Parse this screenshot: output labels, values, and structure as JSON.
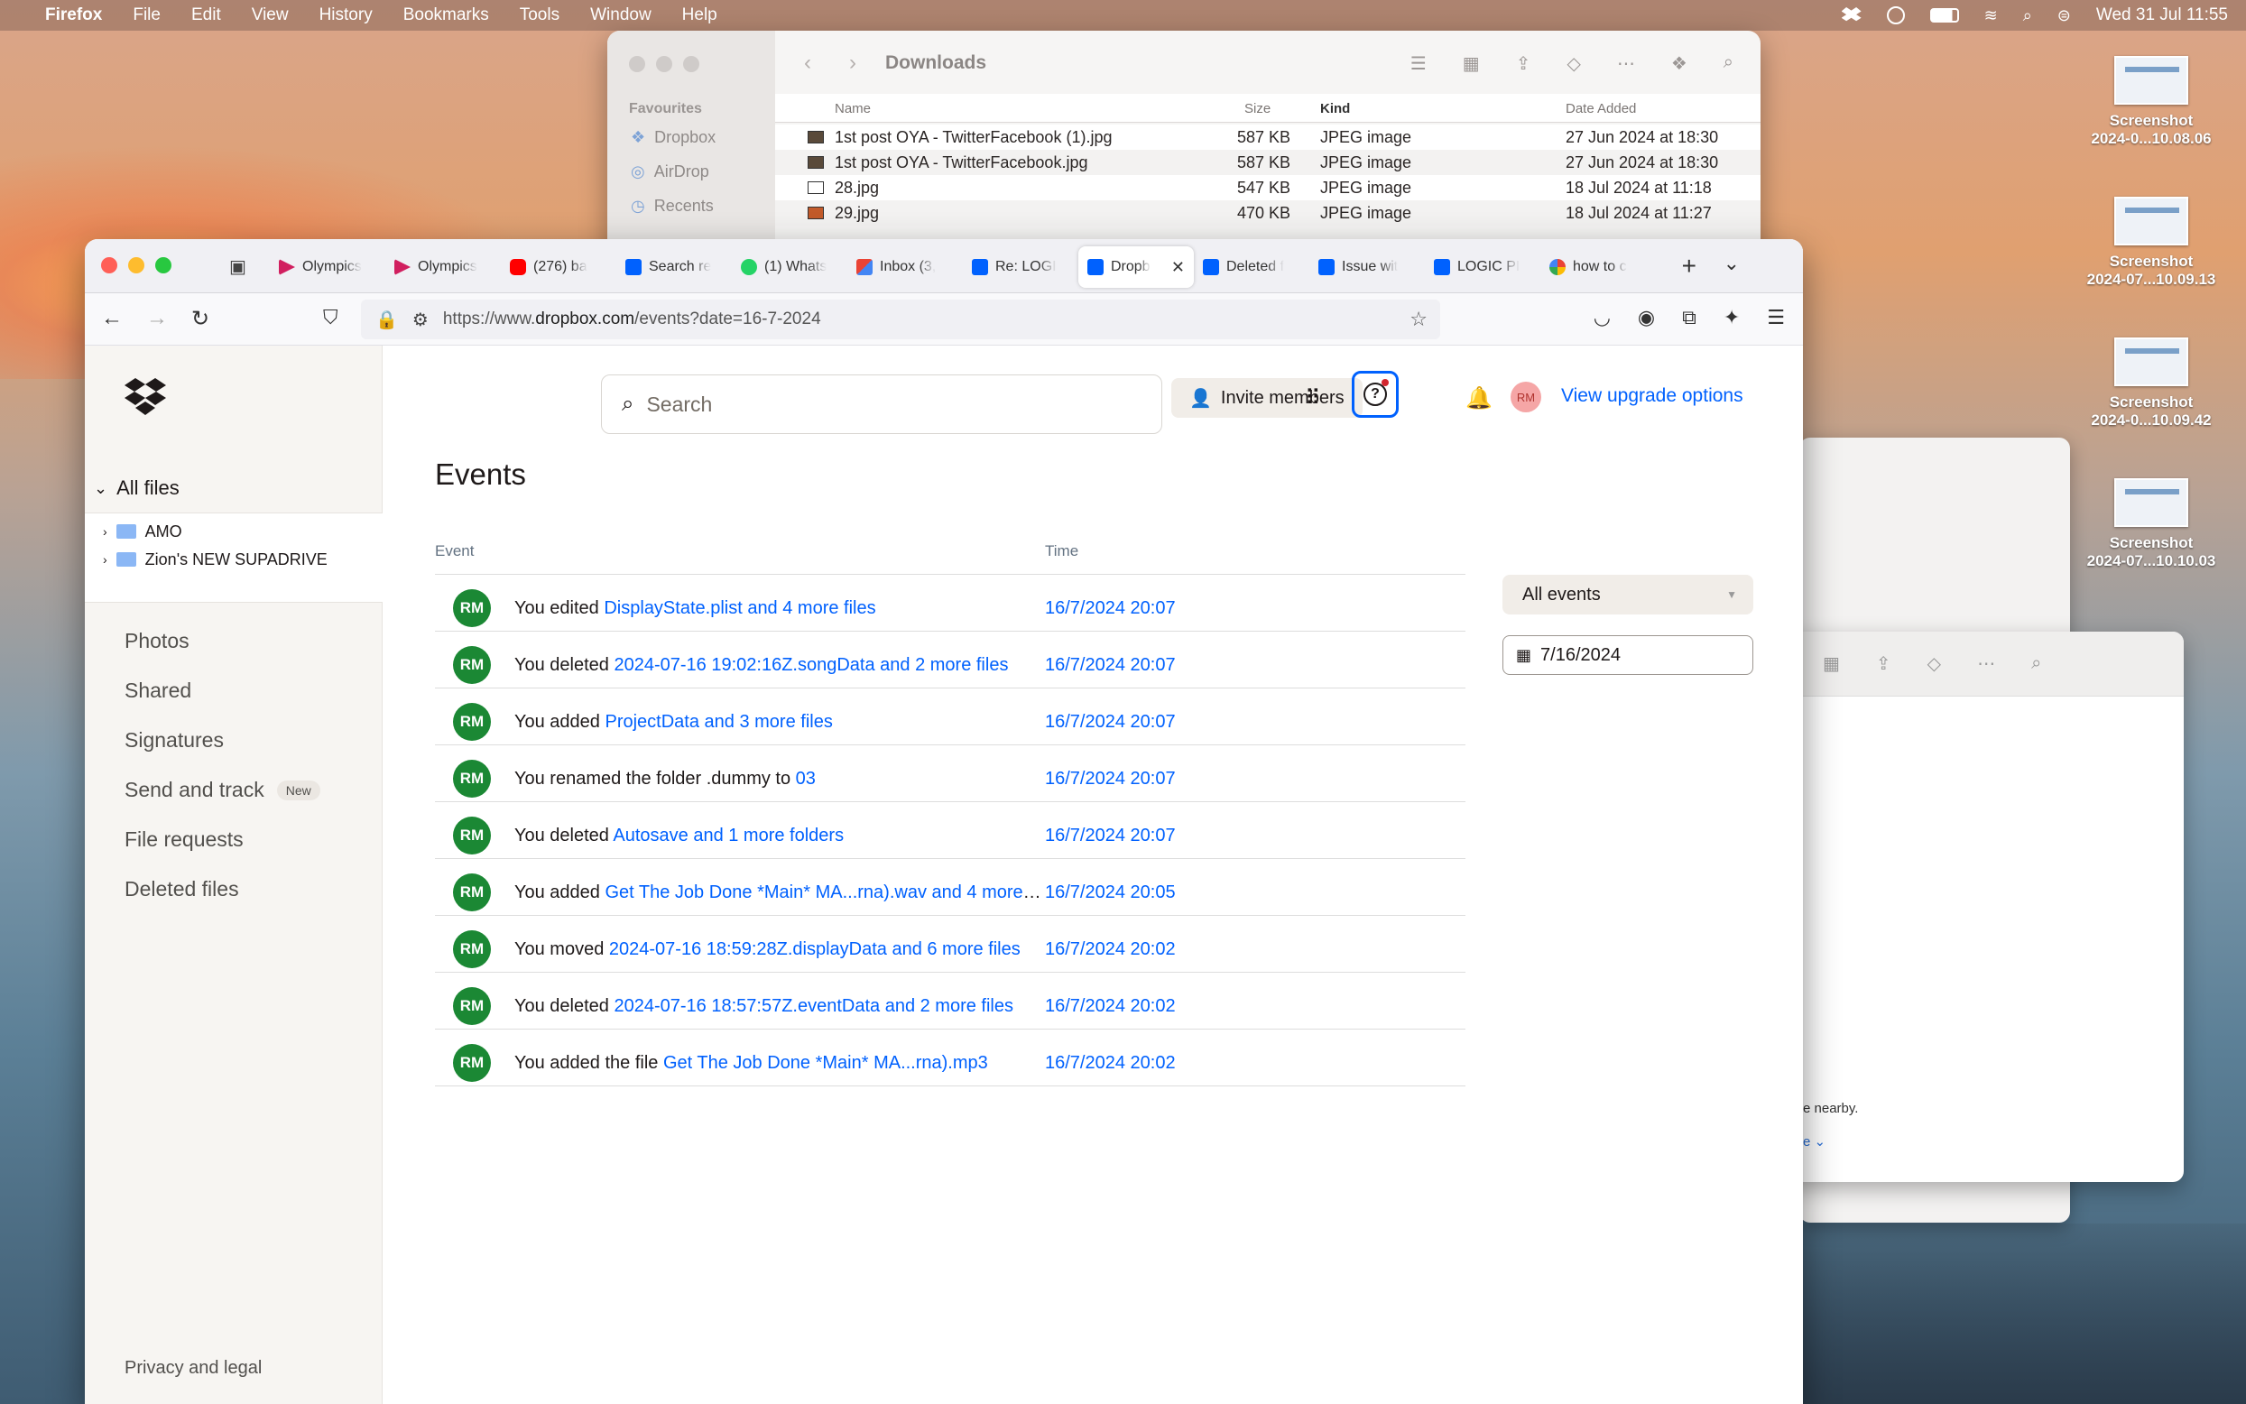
{
  "menubar": {
    "app": "Firefox",
    "menus": [
      "File",
      "Edit",
      "View",
      "History",
      "Bookmarks",
      "Tools",
      "Window",
      "Help"
    ],
    "clock": "Wed 31 Jul  11:55"
  },
  "desktop": {
    "items": [
      {
        "line1": "Screenshot",
        "line2": "2024-0...10.08.06"
      },
      {
        "line1": "Screenshot",
        "line2": "2024-07...10.09.13"
      },
      {
        "line1": "Screenshot",
        "line2": "2024-0...10.09.42"
      },
      {
        "line1": "Screenshot",
        "line2": "2024-07...10.10.03"
      }
    ]
  },
  "finder": {
    "title": "Downloads",
    "favourites_label": "Favourites",
    "sidebar": [
      "Dropbox",
      "AirDrop",
      "Recents"
    ],
    "columns": {
      "name": "Name",
      "size": "Size",
      "kind": "Kind",
      "date": "Date Added"
    },
    "rows": [
      {
        "name": "1st post OYA - TwitterFacebook (1).jpg",
        "size": "587 KB",
        "kind": "JPEG image",
        "date": "27 Jun 2024 at 18:30"
      },
      {
        "name": "1st post OYA - TwitterFacebook.jpg",
        "size": "587 KB",
        "kind": "JPEG image",
        "date": "27 Jun 2024 at 18:30"
      },
      {
        "name": "28.jpg",
        "size": "547 KB",
        "kind": "JPEG image",
        "date": "18 Jul 2024 at 11:18"
      },
      {
        "name": "29.jpg",
        "size": "470 KB",
        "kind": "JPEG image",
        "date": "18 Jul 2024 at 11:27"
      }
    ]
  },
  "finder_back": {
    "nearby_text": "e nearby.",
    "more_text": "e ⌄"
  },
  "browser": {
    "tabs": [
      {
        "label": "Olympics",
        "icon": "olympics-icon"
      },
      {
        "label": "Olympics",
        "icon": "olympics-icon"
      },
      {
        "label": "(276) ba",
        "icon": "youtube-icon"
      },
      {
        "label": "Search re",
        "icon": "dropbox-icon"
      },
      {
        "label": "(1) Whats",
        "icon": "whatsapp-icon"
      },
      {
        "label": "Inbox (3,",
        "icon": "gmail-icon"
      },
      {
        "label": "Re: LOGI",
        "icon": "dropbox-icon"
      },
      {
        "label": "Dropb",
        "icon": "dropbox-icon",
        "active": true
      },
      {
        "label": "Deleted f",
        "icon": "dropbox-icon"
      },
      {
        "label": "Issue wit",
        "icon": "dropbox-icon"
      },
      {
        "label": "LOGIC PI",
        "icon": "dropbox-icon"
      },
      {
        "label": "how to c",
        "icon": "google-icon"
      }
    ],
    "url_prefix": "https://www.",
    "url_host": "dropbox.com",
    "url_path": "/events?date=16-7-2024"
  },
  "dropbox": {
    "sidebar": {
      "all_files": "All files",
      "folders": [
        "AMO",
        "Zion's NEW SUPADRIVE"
      ],
      "nav": [
        "Photos",
        "Shared",
        "Signatures",
        "Send and track",
        "File requests",
        "Deleted files"
      ],
      "new_badge": "New",
      "privacy": "Privacy and legal"
    },
    "header": {
      "search_placeholder": "Search",
      "invite": "Invite members",
      "avatar": "RM",
      "upgrade": "View upgrade options"
    },
    "title": "Events",
    "columns": {
      "event": "Event",
      "time": "Time"
    },
    "filter": "All events",
    "date": "7/16/2024",
    "events": [
      {
        "avatar": "RM",
        "prefix": "You edited ",
        "link": "DisplayState.plist and 4 more files",
        "time": "16/7/2024 20:07"
      },
      {
        "avatar": "RM",
        "prefix": "You deleted ",
        "link": "2024-07-16 19:02:16Z.songData and 2 more files",
        "time": "16/7/2024 20:07"
      },
      {
        "avatar": "RM",
        "prefix": "You added ",
        "link": "ProjectData and 3 more files",
        "time": "16/7/2024 20:07"
      },
      {
        "avatar": "RM",
        "prefix": "You renamed the folder .dummy to ",
        "link": "03",
        "time": "16/7/2024 20:07"
      },
      {
        "avatar": "RM",
        "prefix": "You deleted ",
        "link": "Autosave and 1 more folders",
        "time": "16/7/2024 20:07"
      },
      {
        "avatar": "RM",
        "prefix": "You added ",
        "link": "Get The Job Done *Main* MA...rna).wav and 4 more files",
        "time": "16/7/2024 20:05"
      },
      {
        "avatar": "RM",
        "prefix": "You moved ",
        "link": "2024-07-16 18:59:28Z.displayData and 6 more files",
        "time": "16/7/2024 20:02"
      },
      {
        "avatar": "RM",
        "prefix": "You deleted ",
        "link": "2024-07-16 18:57:57Z.eventData and 2 more files",
        "time": "16/7/2024 20:02"
      },
      {
        "avatar": "RM",
        "prefix": "You added the file ",
        "link": "Get The Job Done *Main* MA...rna).mp3",
        "time": "16/7/2024 20:02"
      }
    ]
  },
  "colors": {
    "accent": "#0061fe",
    "avatar_green": "#1b8834"
  }
}
